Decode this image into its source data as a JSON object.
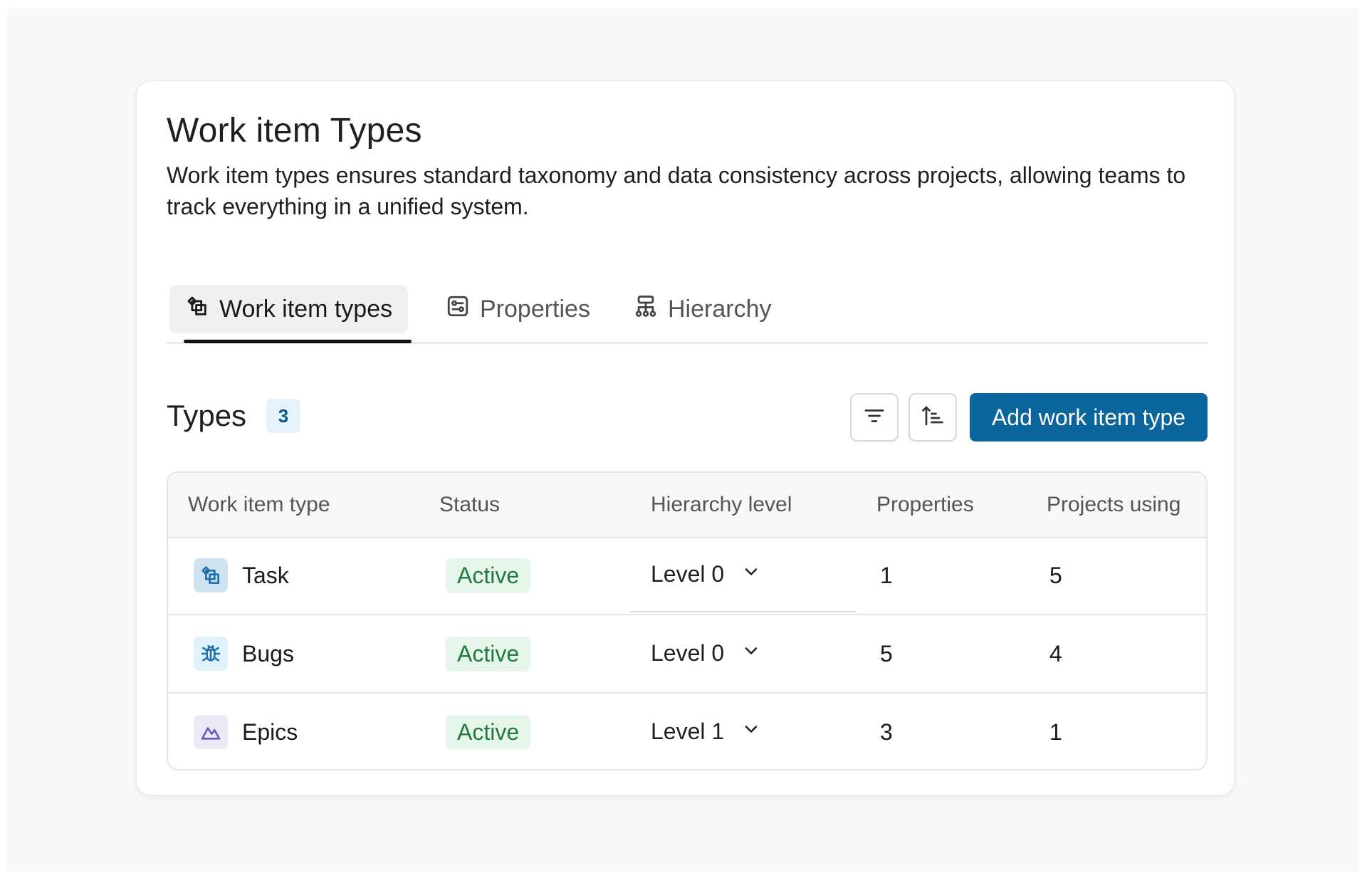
{
  "header": {
    "title": "Work item Types",
    "description": "Work item types ensures standard taxonomy and data consistency across projects, allowing teams to track everything in a unified system."
  },
  "tabs": [
    {
      "label": "Work item types",
      "icon": "work-item-types-icon",
      "active": true
    },
    {
      "label": "Properties",
      "icon": "properties-icon",
      "active": false
    },
    {
      "label": "Hierarchy",
      "icon": "hierarchy-icon",
      "active": false
    }
  ],
  "section": {
    "title": "Types",
    "count": "3",
    "filter_icon": "filter-icon",
    "sort_icon": "sort-icon",
    "add_button_label": "Add work item type"
  },
  "table": {
    "columns": [
      "Work item type",
      "Status",
      "Hierarchy level",
      "Properties",
      "Projects using"
    ],
    "rows": [
      {
        "name": "Task",
        "icon": "task-icon",
        "status": "Active",
        "level": "Level 0",
        "properties": "1",
        "projects": "5"
      },
      {
        "name": "Bugs",
        "icon": "bug-icon",
        "status": "Active",
        "level": "Level 0",
        "properties": "5",
        "projects": "4"
      },
      {
        "name": "Epics",
        "icon": "epic-icon",
        "status": "Active",
        "level": "Level 1",
        "properties": "3",
        "projects": "1"
      }
    ]
  },
  "colors": {
    "primary": "#0b669e",
    "status_bg": "#e6f6ea",
    "status_text": "#217a3e",
    "badge_bg": "#e4f3fb",
    "task_icon_bg": "#cfe2ef",
    "bug_icon_bg": "#dff1fb",
    "epic_icon_bg": "#ece9f7"
  }
}
